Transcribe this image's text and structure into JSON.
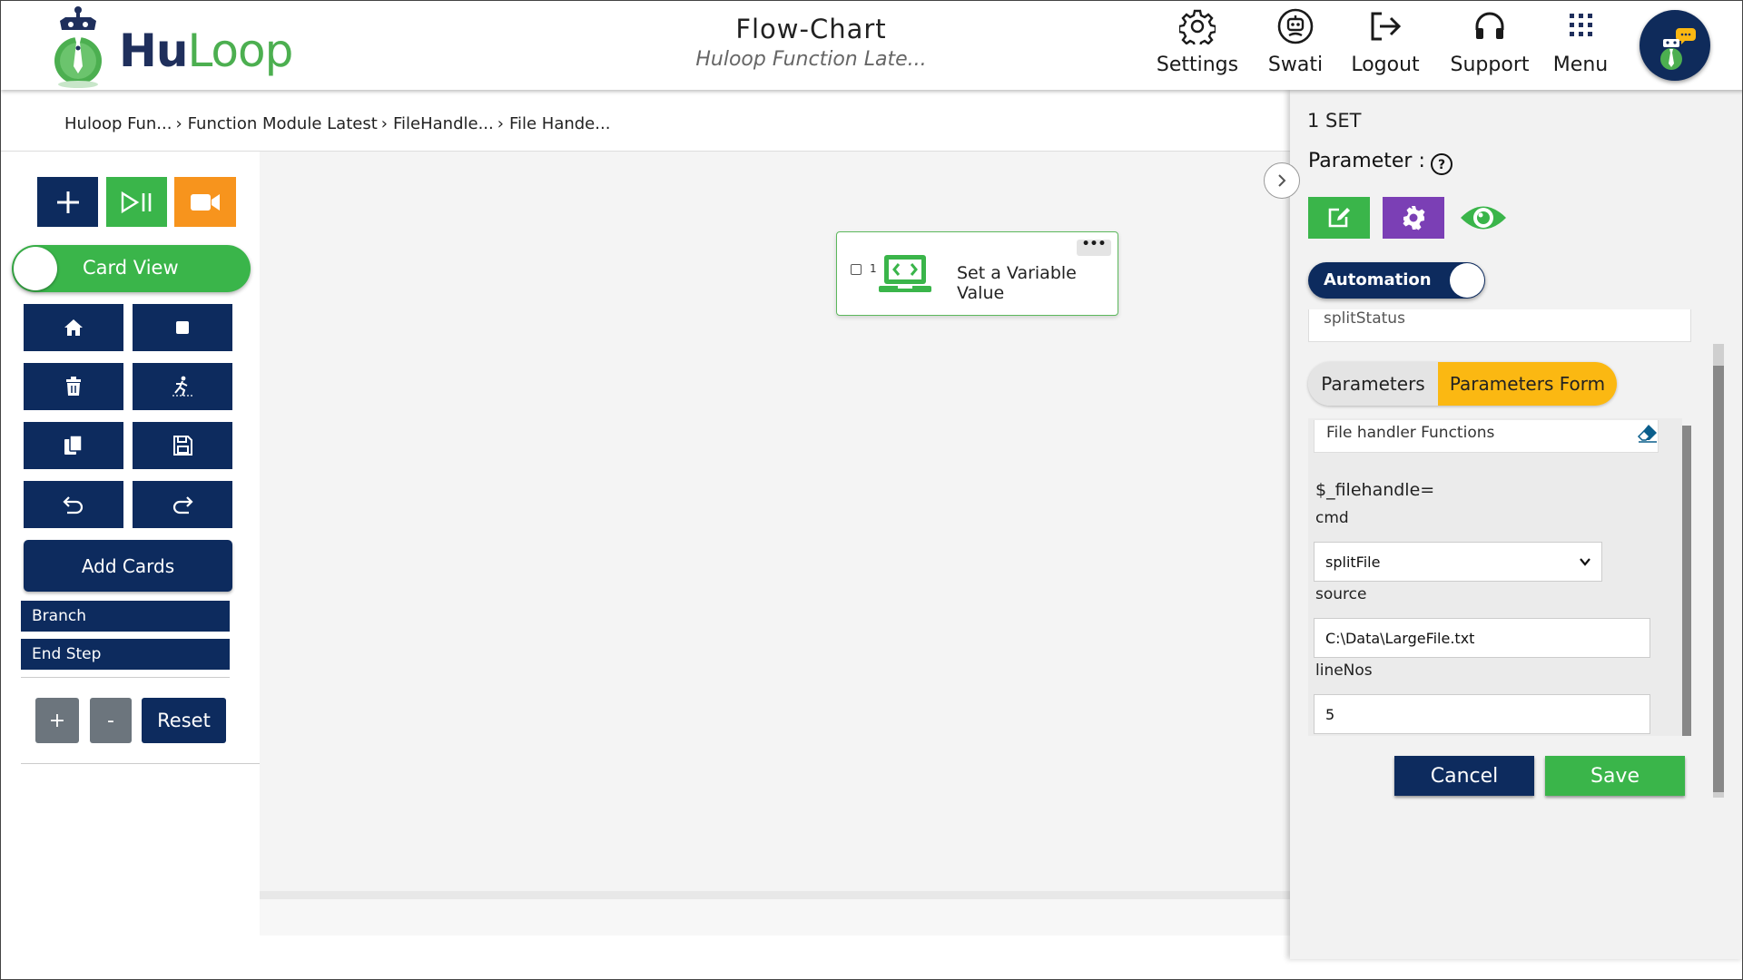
{
  "app": {
    "brand_part1": "Hu",
    "brand_part2": "Loop",
    "title": "Flow-Chart",
    "subtitle": "Huloop Function Late..."
  },
  "header_nav": [
    {
      "label": "Settings",
      "icon": "gear-icon"
    },
    {
      "label": "Swati",
      "icon": "user-robot-icon"
    },
    {
      "label": "Logout",
      "icon": "logout-icon"
    },
    {
      "label": "Support",
      "icon": "headset-icon"
    },
    {
      "label": "Menu",
      "icon": "grid-menu-icon"
    }
  ],
  "breadcrumb": [
    "Huloop Fun...",
    "Function Module Latest",
    "FileHandle...",
    "File Hande..."
  ],
  "toolbox": {
    "card_view_label": "Card View",
    "add_cards_label": "Add Cards",
    "branch_label": "Branch",
    "end_step_label": "End Step",
    "zoom_in_label": "+",
    "zoom_out_label": "-",
    "reset_label": "Reset"
  },
  "canvas": {
    "card": {
      "number": "1",
      "label": "Set a Variable Value",
      "menu": "•••"
    }
  },
  "panel": {
    "title": "1 SET",
    "parameter_label": "Parameter :",
    "automation_label": "Automation",
    "prev_field_value": "splitStatus",
    "tabs": [
      "Parameters",
      "Parameters Form"
    ],
    "active_tab": "Parameters Form",
    "function_field": "File handler Functions",
    "variable": "$_filehandle=",
    "fields": {
      "cmd_label": "cmd",
      "cmd_value": "splitFile",
      "source_label": "source",
      "source_value": "C:\\Data\\LargeFile.txt",
      "linenos_label": "lineNos",
      "linenos_value": "5"
    },
    "cancel_label": "Cancel",
    "save_label": "Save"
  },
  "colors": {
    "navy": "#0d2b5e",
    "green": "#3ab54a",
    "orange": "#f7941d",
    "purple": "#7b3fb5",
    "tab_active": "#fbb812"
  }
}
